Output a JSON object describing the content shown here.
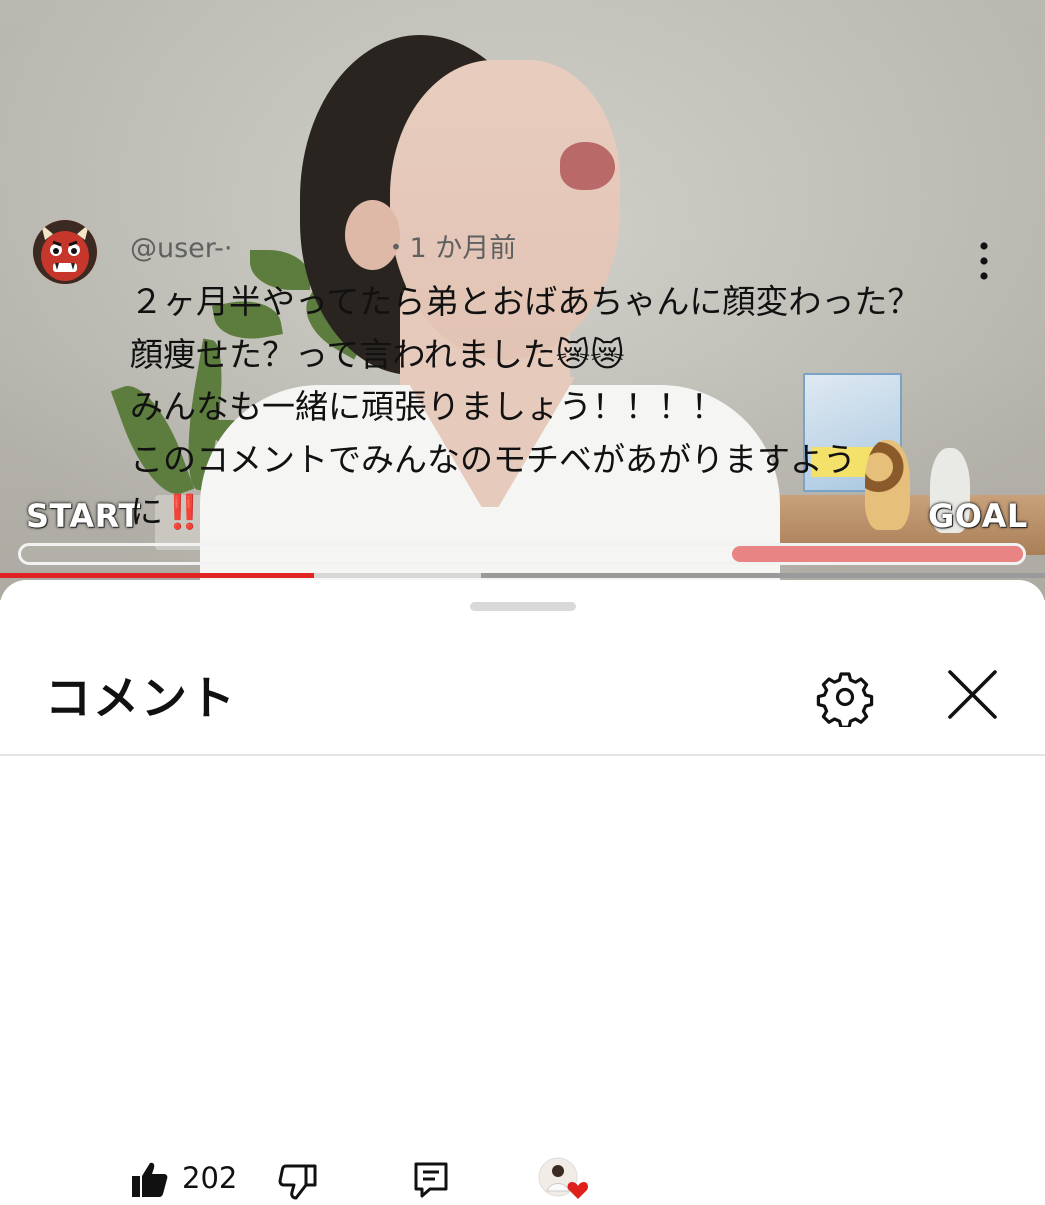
{
  "video": {
    "start_label": "START",
    "goal_label": "GOAL",
    "goal_progress": 0.29,
    "playback_progress": 0.3,
    "buffered_progress": 0.46
  },
  "comments_panel": {
    "title": "コメント",
    "icons": {
      "settings": "gear-icon",
      "close": "close-icon",
      "menu": "vertical-dots-icon"
    }
  },
  "comment": {
    "author": "@user-",
    "author_hidden_suffix": "·",
    "time_separator": "・",
    "time": "1 か月前",
    "avatar_icon": "ogre-emoji",
    "lines": [
      "２ヶ月半やってたら弟とおばあちゃんに顔変わった？",
      "顔痩せた？って言われました😿😿",
      "みんなも一緒に頑張りましょう！！！！",
      "このコメントでみんなのモチベがあがりますよう",
      "に‼️"
    ],
    "like_count": "202",
    "icons": {
      "like": "thumbs-up-filled-icon",
      "dislike": "thumbs-down-icon",
      "reply": "reply-icon",
      "creator_heart": "creator-heart-icon"
    }
  },
  "colors": {
    "progress_fill": "#e98484",
    "playback_red": "#e02424",
    "heart_red": "#e0201a"
  }
}
